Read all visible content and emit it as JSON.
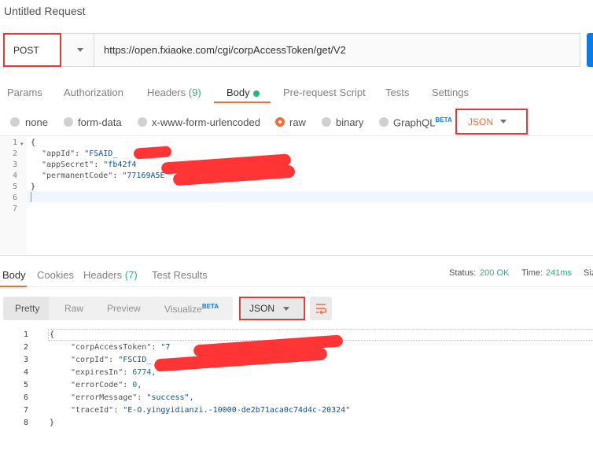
{
  "app": {
    "title": "Untitled Request"
  },
  "request": {
    "method": "POST",
    "url": "https://open.fxiaoke.com/cgi/corpAccessToken/get/V2"
  },
  "tabs": [
    {
      "label": "Params"
    },
    {
      "label": "Authorization"
    },
    {
      "label": "Headers",
      "count": "(9)"
    },
    {
      "label": "Body",
      "active": true
    },
    {
      "label": "Pre-request Script"
    },
    {
      "label": "Tests"
    },
    {
      "label": "Settings"
    }
  ],
  "body_types": [
    {
      "label": "none"
    },
    {
      "label": "form-data"
    },
    {
      "label": "x-www-form-urlencoded"
    },
    {
      "label": "raw",
      "selected": true
    },
    {
      "label": "binary"
    },
    {
      "label": "GraphQL",
      "badge": "BETA"
    }
  ],
  "body_format": "JSON",
  "request_body": {
    "line_numbers": [
      "1",
      "2",
      "3",
      "4",
      "5",
      "6",
      "7"
    ],
    "lines": [
      "{",
      "\"appId\"",
      "\"FSAID_",
      "\"appSecret\"",
      "\"fb42f4",
      "\"permanentCode\"",
      "\"77169A5E",
      "}"
    ]
  },
  "response_tabs": [
    {
      "label": "Body",
      "active": true
    },
    {
      "label": "Cookies"
    },
    {
      "label": "Headers",
      "count": "(7)"
    },
    {
      "label": "Test Results"
    }
  ],
  "response_meta": {
    "status_label": "Status:",
    "status_value": "200 OK",
    "time_label": "Time:",
    "time_value": "241ms",
    "size_label": "Siz"
  },
  "response_views": [
    {
      "label": "Pretty",
      "active": true
    },
    {
      "label": "Raw"
    },
    {
      "label": "Preview"
    },
    {
      "label": "Visualize",
      "badge": "BETA"
    }
  ],
  "response_format": "JSON",
  "response_body": {
    "line_numbers": [
      "1",
      "2",
      "3",
      "4",
      "5",
      "6",
      "7",
      "8"
    ],
    "open_brace": "{",
    "close_brace": "}",
    "key_corpAccessToken": "\"corpAccessToken\"",
    "val_corpAccessToken": "\"7",
    "key_corpId": "\"corpId\"",
    "val_corpId": "\"FSCID_",
    "key_expiresIn": "\"expiresIn\"",
    "val_expiresIn": "6774",
    "key_errorCode": "\"errorCode\"",
    "val_errorCode": "0",
    "key_errorMessage": "\"errorMessage\"",
    "val_errorMessage": "\"success\"",
    "key_traceId": "\"traceId\"",
    "val_traceId": "\"E-O.yingyidianzi.-10000-de2b71aca0c74d4c-20324\""
  },
  "colors": {
    "accent": "#f26b3a",
    "success": "#26b47f",
    "annotation": "#e53935",
    "send_button": "#097bed"
  },
  "icons": [
    "chevron-down-icon",
    "wrap-lines-icon",
    "fold-arrow-icon"
  ]
}
